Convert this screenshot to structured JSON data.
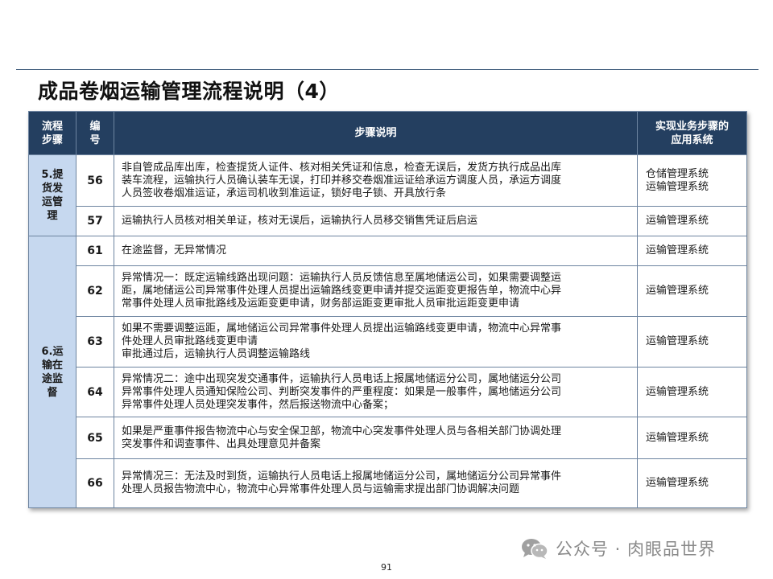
{
  "title": "成品卷烟运输管理流程说明（4）",
  "table": {
    "headers": {
      "stage": [
        "流程",
        "步骤"
      ],
      "number": [
        "编",
        "号"
      ],
      "description": [
        "步骤说明"
      ],
      "system": [
        "实现业务步骤的",
        "应用系统"
      ]
    },
    "groups": [
      {
        "stage": [
          "5.提",
          "货发",
          "运管",
          "理"
        ],
        "rows": [
          {
            "number": "56",
            "description": [
              "非自管成品库出库，检查提货人证件、核对相关凭证和信息，检查无误后，发货方执行成品出库",
              "装车流程，运输执行人员确认装车无误，打印并移交卷烟准运证给承运方调度人员，承运方调度",
              "人员签收卷烟准运证，承运司机收到准运证，锁好电子锁、开具放行条"
            ],
            "systems": [
              "仓储管理系统",
              "运输管理系统"
            ]
          },
          {
            "number": "57",
            "description": [
              "运输执行人员核对相关单证，核对无误后，运输执行人员移交销售凭证后启运"
            ],
            "systems": [
              "运输管理系统"
            ]
          }
        ]
      },
      {
        "stage": [
          "6.运",
          "输在",
          "途监",
          "督"
        ],
        "rows": [
          {
            "number": "61",
            "description": [
              "在途监督，无异常情况"
            ],
            "systems": [
              "运输管理系统"
            ]
          },
          {
            "number": "62",
            "description": [
              "异常情况一：既定运输线路出现问题：运输执行人员反馈信息至属地储运公司，如果需要调整运",
              "距，属地储运公司异常事件处理人员提出运输路线变更申请并提交运距变更报告单，物流中心异",
              "常事件处理人员审批路线及运距变更申请，财务部运距变更审批人员审批运距变更申请"
            ],
            "systems": [
              "运输管理系统"
            ]
          },
          {
            "number": "63",
            "description": [
              "如果不需要调整运距，属地储运公司异常事件处理人员提出运输路线变更申请，物流中心异常事",
              "件处理人员审批路线变更申请",
              "审批通过后，运输执行人员调整运输路线"
            ],
            "systems": [
              "运输管理系统"
            ]
          },
          {
            "number": "64",
            "description": [
              "异常情况二：途中出现突发交通事件，运输执行人员电话上报属地储运分公司，属地储运分公司",
              "异常事件处理人员通知保险公司、判断突发事件的严重程度：如果是一般事件，属地储运分公司",
              "异常事件处理人员处理突发事件，然后报送物流中心备案；"
            ],
            "systems": [
              "运输管理系统"
            ]
          },
          {
            "number": "65",
            "description": [
              "如果是严重事件报告物流中心与安全保卫部，物流中心突发事件处理人员与各相关部门协调处理",
              "突发事件和调查事件、出具处理意见并备案"
            ],
            "systems": [
              "运输管理系统"
            ]
          },
          {
            "number": "66",
            "description": [
              "异常情况三：无法及时到货，运输执行人员电话上报属地储运分公司，属地储运分公司异常事件",
              "处理人员报告物流中心，物流中心异常事件处理人员与运输需求提出部门协调解决问题"
            ],
            "systems": [
              "运输管理系统"
            ]
          }
        ]
      }
    ]
  },
  "watermark": {
    "text": "公众号 · 肉眼品世界",
    "icon": "wechat-icon"
  },
  "page_number": "91",
  "colors": {
    "header_bg": "#243f60",
    "stage_bg": "#c6d8ef",
    "border": "#6d84a0"
  }
}
